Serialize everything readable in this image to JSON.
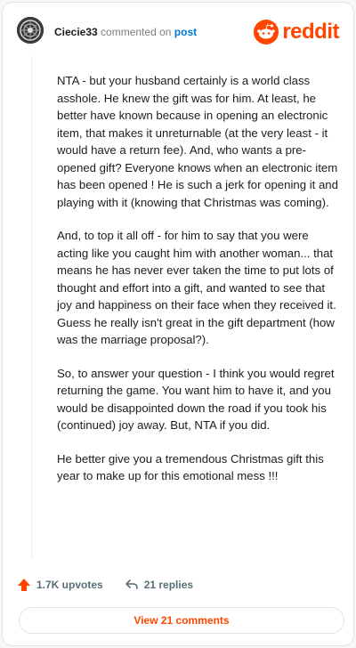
{
  "header": {
    "username": "Ciecie33",
    "action_text": "commented on",
    "post_link": "post",
    "logo_text": "reddit"
  },
  "comment": {
    "paragraphs": [
      "NTA - but your husband certainly is a world class asshole. He knew the gift was for him. At least, he better have known because in opening an electronic item, that makes it unreturnable (at the very least - it would have a return fee). And, who wants a pre-opened gift? Everyone knows when an electronic item has been opened ! He is such a jerk for opening it and playing with it (knowing that Christmas was coming).",
      "And, to top it all off - for him to say that you were acting like you caught him with another woman... that means he has never ever taken the time to put lots of thought and effort into a gift, and wanted to see that joy and happiness on their face when they received it. Guess he really isn't great in the gift department (how was the marriage proposal?).",
      "So, to answer your question - I think you would regret returning the game. You want him to have it, and you would be disappointed down the road if you took his (continued) joy away. But, NTA if you did.",
      "He better give you a tremendous Christmas gift this year to make up for this emotional mess !!!"
    ]
  },
  "footer": {
    "upvotes": "1.7K upvotes",
    "replies": "21 replies",
    "view_button": "View 21 comments"
  },
  "colors": {
    "brand": "#ff4500",
    "link": "#0079d3",
    "muted": "#576f76"
  },
  "icons": [
    "avatar",
    "reddit-snoo-icon",
    "upvote-arrow-icon",
    "reply-arrow-icon"
  ]
}
